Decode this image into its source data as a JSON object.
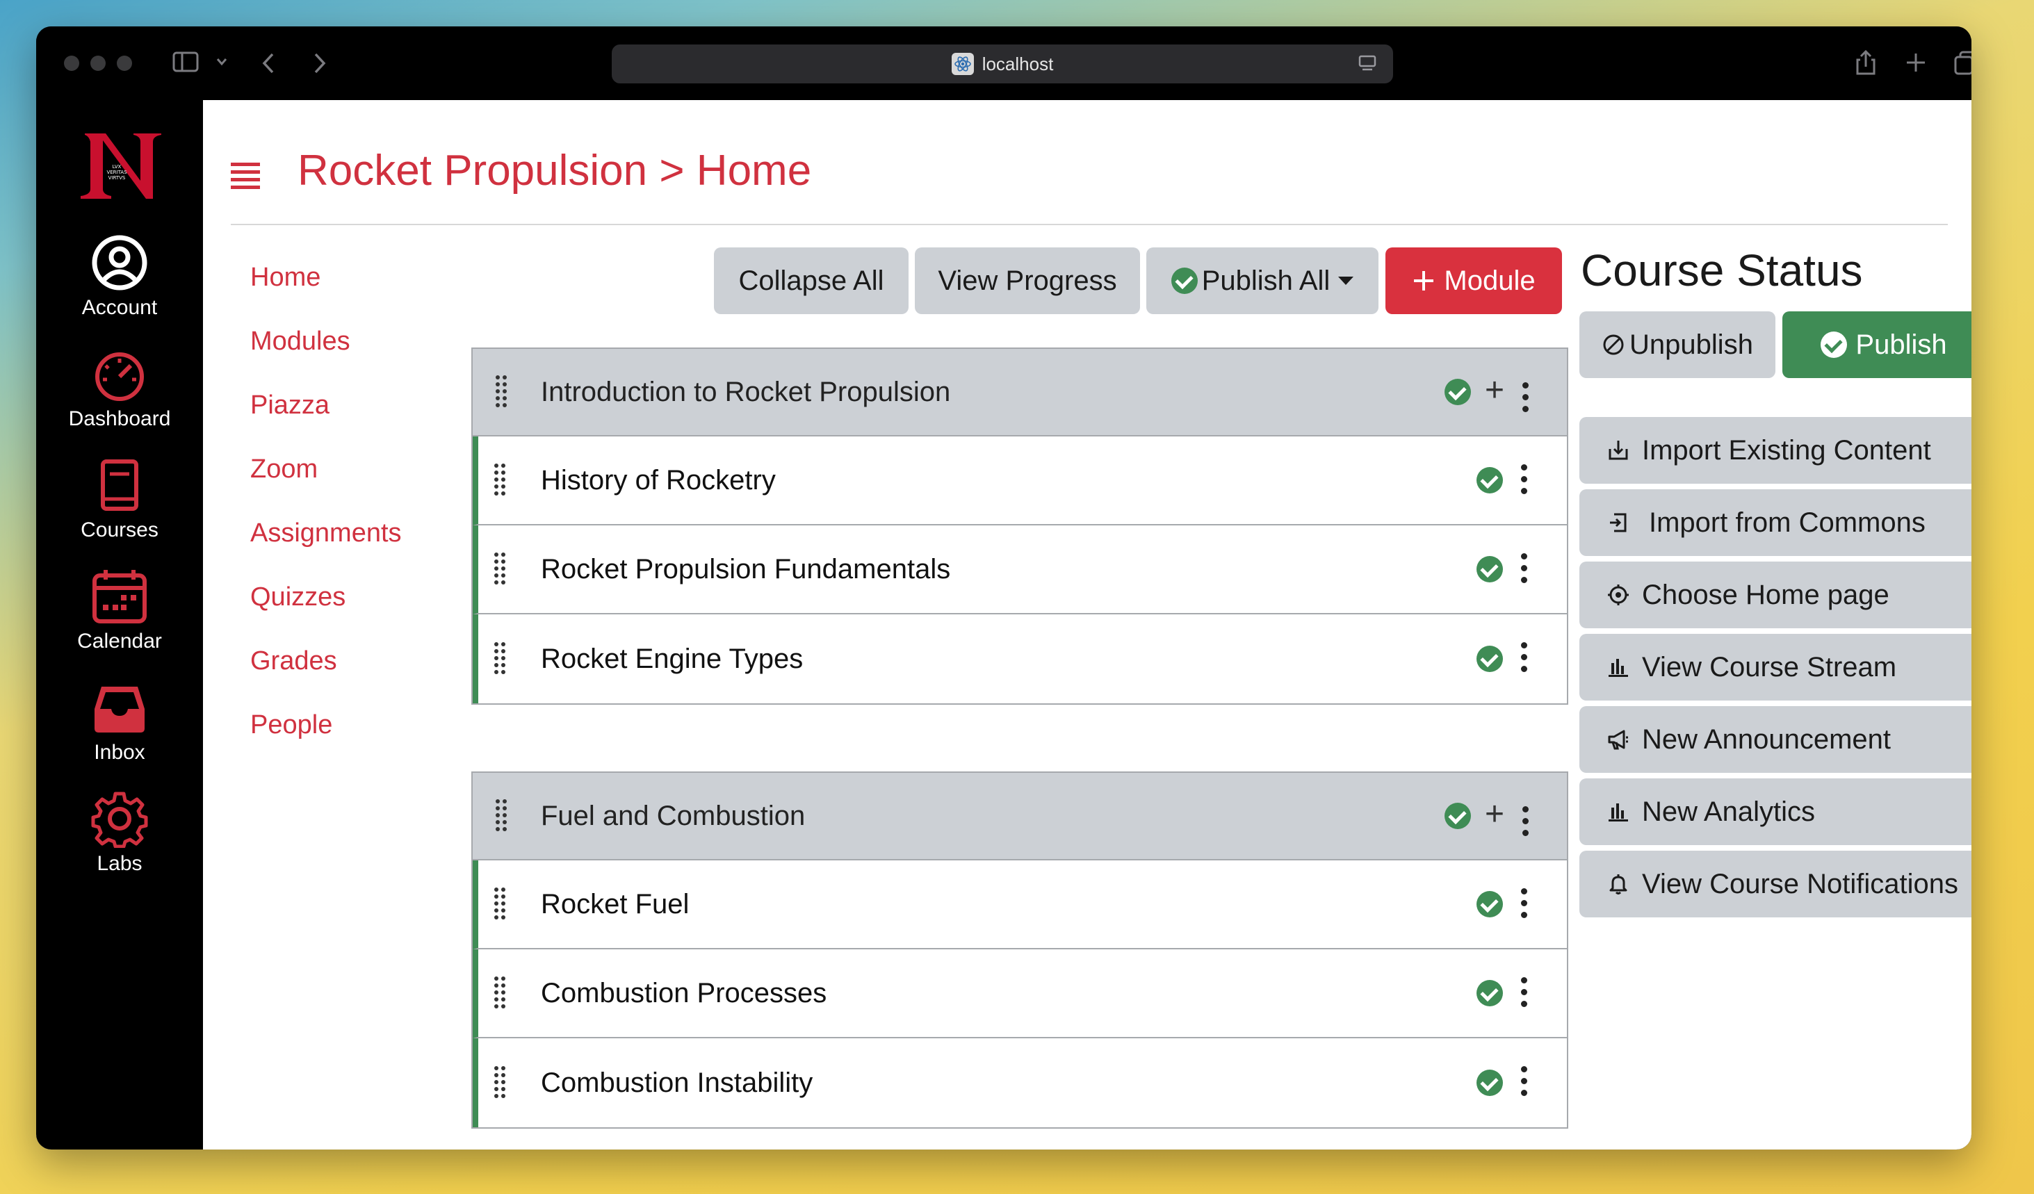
{
  "browser": {
    "url": "localhost"
  },
  "kanbas_nav": [
    {
      "label": "Account",
      "icon": "account-icon"
    },
    {
      "label": "Dashboard",
      "icon": "dashboard-icon"
    },
    {
      "label": "Courses",
      "icon": "book-icon"
    },
    {
      "label": "Calendar",
      "icon": "calendar-icon"
    },
    {
      "label": "Inbox",
      "icon": "inbox-icon"
    },
    {
      "label": "Labs",
      "icon": "gear-icon"
    }
  ],
  "header": {
    "breadcrumb": "Rocket Propulsion > Home"
  },
  "course_nav": [
    "Home",
    "Modules",
    "Piazza",
    "Zoom",
    "Assignments",
    "Quizzes",
    "Grades",
    "People"
  ],
  "toolbar": {
    "collapse_all": "Collapse All",
    "view_progress": "View Progress",
    "publish_all": "Publish All",
    "add_module": "Module"
  },
  "modules": [
    {
      "title": "Introduction to Rocket Propulsion",
      "lessons": [
        "History of Rocketry",
        "Rocket Propulsion Fundamentals",
        "Rocket Engine Types"
      ]
    },
    {
      "title": "Fuel and Combustion",
      "lessons": [
        "Rocket Fuel",
        "Combustion Processes",
        "Combustion Instability"
      ]
    }
  ],
  "course_status": {
    "title": "Course Status",
    "unpublish": "Unpublish",
    "publish": "Publish",
    "actions": [
      {
        "label": "Import Existing Content",
        "icon": "import-icon"
      },
      {
        "label": "Import from Commons",
        "icon": "commons-import-icon"
      },
      {
        "label": "Choose Home page",
        "icon": "target-icon"
      },
      {
        "label": "View Course Stream",
        "icon": "bar-chart-icon"
      },
      {
        "label": "New Announcement",
        "icon": "megaphone-icon"
      },
      {
        "label": "New Analytics",
        "icon": "bar-chart-icon"
      },
      {
        "label": "View Course Notifications",
        "icon": "bell-icon"
      }
    ]
  },
  "colors": {
    "accent_red": "#d0313f",
    "published_green": "#3f8c55",
    "button_gray": "#ccd0d5"
  }
}
